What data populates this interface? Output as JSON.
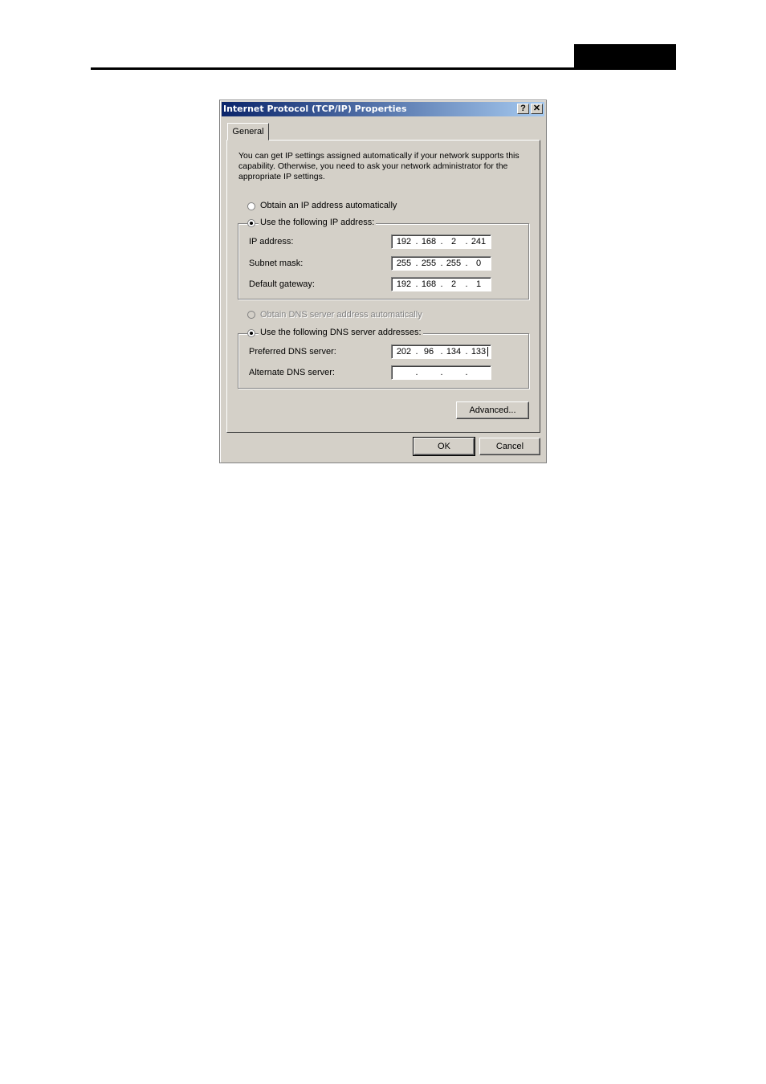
{
  "window": {
    "title": "Internet Protocol (TCP/IP) Properties",
    "help_label": "?",
    "close_label": "✕"
  },
  "tabs": [
    {
      "label": "General",
      "active": true
    }
  ],
  "description": "You can get IP settings assigned automatically if your network supports this capability. Otherwise, you need to ask your network administrator for the appropriate IP settings.",
  "ip_mode": {
    "auto_label": "Obtain an IP address automatically",
    "manual_label": "Use the following IP address:",
    "selected": "manual"
  },
  "ip_fields": {
    "ip_address": {
      "label": "IP address:",
      "octets": [
        "192",
        "168",
        "2",
        "241"
      ]
    },
    "subnet_mask": {
      "label": "Subnet mask:",
      "octets": [
        "255",
        "255",
        "255",
        "0"
      ]
    },
    "default_gateway": {
      "label": "Default gateway:",
      "octets": [
        "192",
        "168",
        "2",
        "1"
      ]
    }
  },
  "dns_mode": {
    "auto_label": "Obtain DNS server address automatically",
    "manual_label": "Use the following DNS server addresses:",
    "selected": "manual",
    "auto_disabled": true
  },
  "dns_fields": {
    "preferred": {
      "label": "Preferred DNS server:",
      "octets": [
        "202",
        "96",
        "134",
        "133"
      ]
    },
    "alternate": {
      "label": "Alternate DNS server:",
      "octets": [
        "",
        "",
        "",
        ""
      ]
    }
  },
  "buttons": {
    "advanced": "Advanced...",
    "ok": "OK",
    "cancel": "Cancel"
  }
}
